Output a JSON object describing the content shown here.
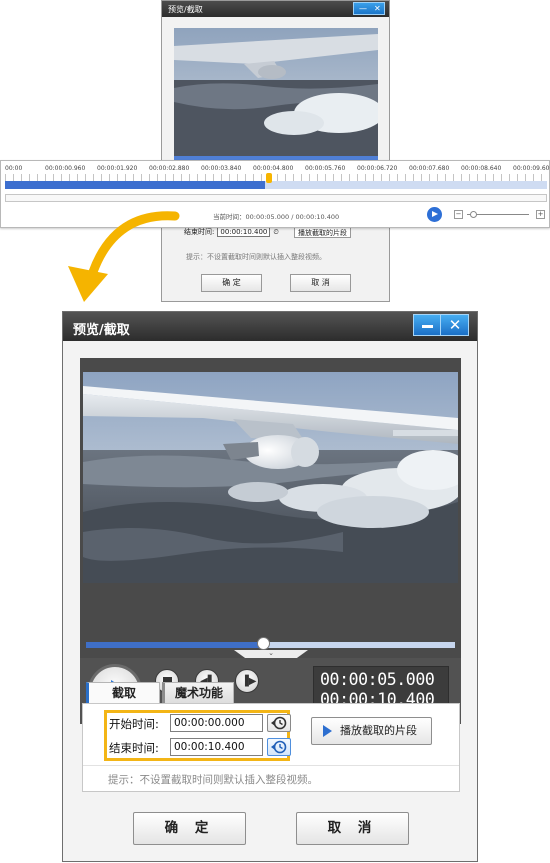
{
  "small_window": {
    "title": "预览/截取",
    "min_glyph": "—",
    "close_glyph": "✕",
    "end_label": "结束时间:",
    "end_value": "00:00:10.400",
    "play_segment": "播放截取的片段",
    "hint": "提示：不设置截取时间则默认插入整段视频。",
    "ok": "确  定",
    "cancel": "取  消"
  },
  "timeline": {
    "ticks": [
      "00:00",
      "00:00:00.960",
      "00:00:01.920",
      "00:00:02.880",
      "00:00:03.840",
      "00:00:04.800",
      "00:00:05.760",
      "00:00:06.720",
      "00:00:07.680",
      "00:00:08.640",
      "00:00:09.600"
    ],
    "progress": 0.48,
    "current_time_text": "当前时间：00:00:05.000 / 00:00:10.400",
    "zoom_minus": "−",
    "zoom_plus": "+",
    "zoom_level": 0.05
  },
  "window": {
    "title": "预览/截取",
    "close_glyph": "✕"
  },
  "player": {
    "progress": 0.48,
    "volume": 0.98,
    "notch": "⌄",
    "speaker_glyph": "◀|",
    "prev_glyph": "◀▌",
    "next_glyph": "▐▶",
    "current_time": "00:00:05.000",
    "total_time": "00:00:10.400"
  },
  "tabs": [
    {
      "label": "截取",
      "active": true
    },
    {
      "label": "魔术功能",
      "active": false
    }
  ],
  "cut": {
    "start_label": "开始时间:",
    "start_value": "00:00:00.000",
    "end_label": "结束时间:",
    "end_value": "00:00:10.400",
    "play_segment_label": "播放截取的片段",
    "hint": "提示：不设置截取时间则默认插入整段视频。"
  },
  "buttons": {
    "ok": "确 定",
    "cancel": "取 消"
  },
  "colors": {
    "accent_blue": "#2a6fc8",
    "highlight_orange": "#f3b516",
    "arrow_orange": "#f5b400",
    "titlebar": "#3a3a3a"
  }
}
